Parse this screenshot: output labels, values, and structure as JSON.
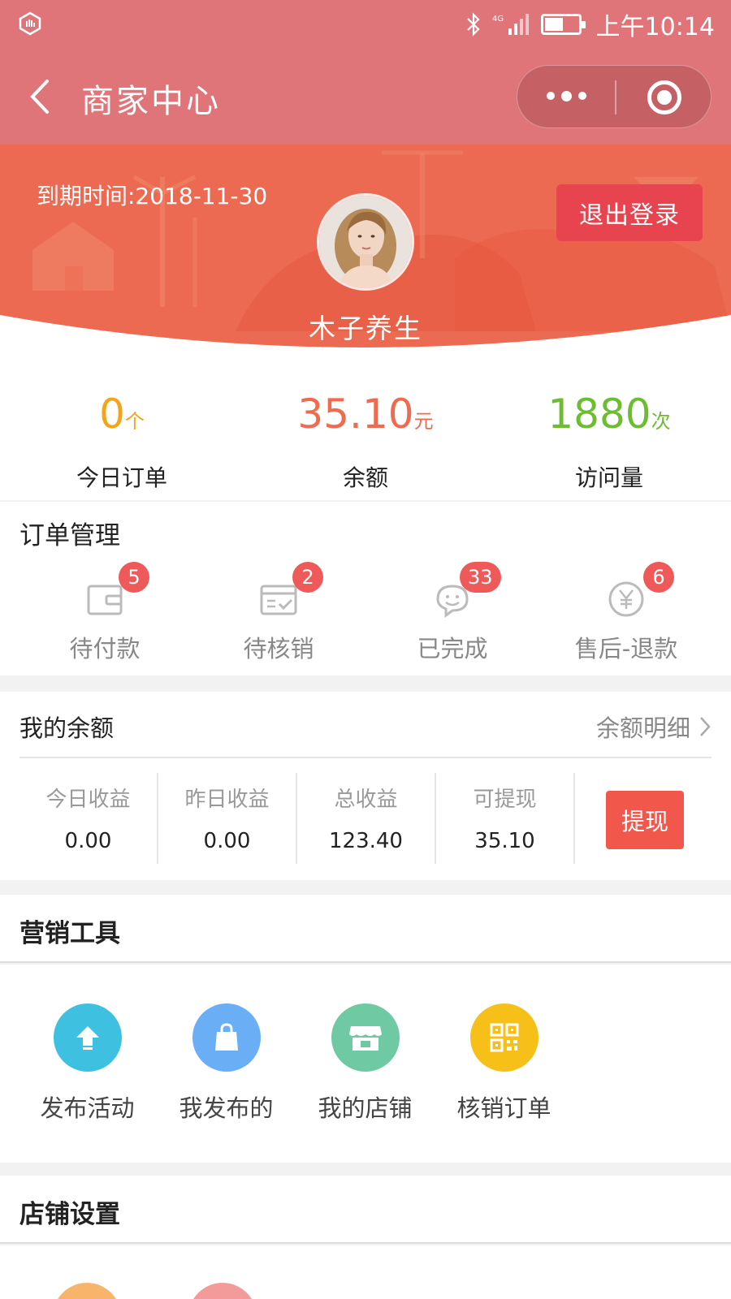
{
  "status_bar": {
    "time": "上午10:14",
    "network": "4G"
  },
  "nav": {
    "title": "商家中心"
  },
  "header": {
    "expire_text": "到期时间:2018-11-30",
    "logout_label": "退出登录",
    "shop_name": "木子养生"
  },
  "stats": [
    {
      "value": "0",
      "unit": "个",
      "label": "今日订单",
      "color": "#f4a31a"
    },
    {
      "value": "35.10",
      "unit": "元",
      "label": "余额",
      "color": "#ef6b4f"
    },
    {
      "value": "1880",
      "unit": "次",
      "label": "访问量",
      "color": "#6cbd32"
    }
  ],
  "orders": {
    "title": "订单管理",
    "items": [
      {
        "label": "待付款",
        "badge": "5",
        "icon": "wallet-icon"
      },
      {
        "label": "待核销",
        "badge": "2",
        "icon": "ticket-check-icon"
      },
      {
        "label": "已完成",
        "badge": "33",
        "icon": "chat-smile-icon"
      },
      {
        "label": "售后-退款",
        "badge": "6",
        "icon": "yen-icon"
      }
    ]
  },
  "balance": {
    "title": "我的余额",
    "detail_label": "余额明细",
    "cols": [
      {
        "title": "今日收益",
        "value": "0.00"
      },
      {
        "title": "昨日收益",
        "value": "0.00"
      },
      {
        "title": "总收益",
        "value": "123.40"
      },
      {
        "title": "可提现",
        "value": "35.10"
      }
    ],
    "withdraw_label": "提现"
  },
  "tools": {
    "title": "营销工具",
    "items": [
      {
        "label": "发布活动",
        "icon": "upload-arrow-icon",
        "color": "#3ec1e0"
      },
      {
        "label": "我发布的",
        "icon": "shopping-bag-icon",
        "color": "#6aaef5"
      },
      {
        "label": "我的店铺",
        "icon": "storefront-icon",
        "color": "#6fcaa4"
      },
      {
        "label": "核销订单",
        "icon": "qr-code-icon",
        "color": "#f7c019"
      }
    ]
  },
  "settings": {
    "title": "店铺设置",
    "colors": [
      "#f8b46a",
      "#f39a9a"
    ]
  }
}
